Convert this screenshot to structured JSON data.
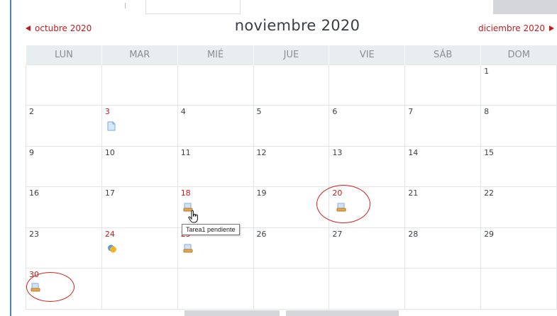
{
  "calendar": {
    "prev_month": "octubre 2020",
    "next_month": "diciembre 2020",
    "title": "noviembre 2020",
    "weekdays": [
      "LUN",
      "MAR",
      "MIÉ",
      "JUE",
      "VIE",
      "SÁB",
      "DOM"
    ],
    "weeks": [
      [
        "",
        "",
        "",
        "",
        "",
        "",
        "1"
      ],
      [
        "2",
        "3",
        "4",
        "5",
        "6",
        "7",
        "8"
      ],
      [
        "9",
        "10",
        "11",
        "12",
        "13",
        "14",
        "15"
      ],
      [
        "16",
        "17",
        "18",
        "19",
        "20",
        "21",
        "22"
      ],
      [
        "23",
        "24",
        "25",
        "26",
        "27",
        "28",
        "29"
      ],
      [
        "30",
        "",
        "",
        "",
        "",
        "",
        ""
      ]
    ]
  },
  "tooltip": "Tarea1 pendiente",
  "icons": {
    "event_doc": "document-icon",
    "event_assign": "assignment-icon",
    "event_forum": "forum-icon",
    "cursor": "hand-cursor-icon"
  },
  "colors": {
    "accent": "#c41a1a",
    "header_bg": "#e8eeef",
    "circle": "#d42020"
  }
}
